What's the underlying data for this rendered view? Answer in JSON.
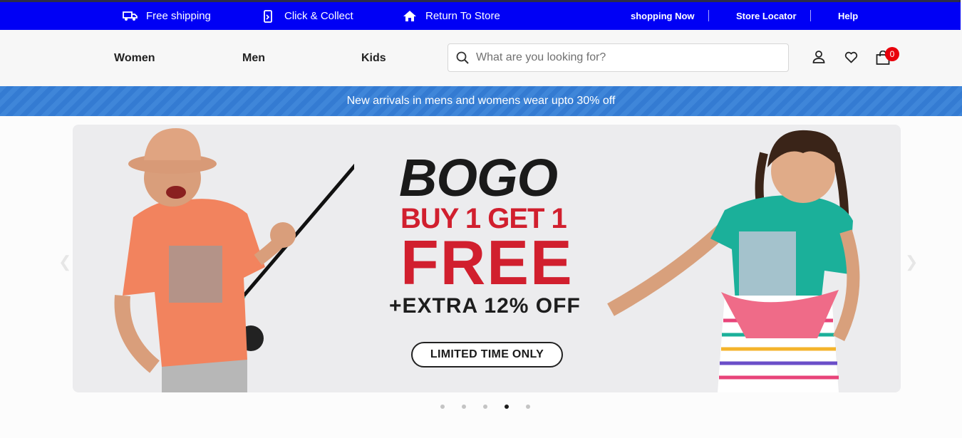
{
  "topbar": {
    "features": [
      {
        "icon": "truck-icon",
        "label": "Free shipping"
      },
      {
        "icon": "mobile-click-icon",
        "label": "Click & Collect"
      },
      {
        "icon": "home-icon",
        "label": "Return To Store"
      }
    ],
    "links": [
      "shopping Now",
      "Store Locator",
      "Help"
    ]
  },
  "header": {
    "nav": [
      "Women",
      "Men",
      "Kids"
    ],
    "search": {
      "placeholder": "What are you looking for?",
      "value": ""
    },
    "icons": [
      "user-icon",
      "heart-icon",
      "cart-icon"
    ],
    "cart_count": "0"
  },
  "promo": {
    "text": "New arrivals in mens and womens wear upto 30% off"
  },
  "hero": {
    "headline": "BOGO",
    "subline": "BUY 1 GET 1",
    "free": "FREE",
    "extra": "+EXTRA 12% OFF",
    "badge": "LIMITED TIME ONLY"
  },
  "carousel": {
    "slides": 5,
    "active_index": 3
  },
  "colors": {
    "topbar": "#0000f5",
    "promo": "#3f86d9",
    "accent_red": "#d11f2e",
    "badge_red": "#e8000b"
  }
}
